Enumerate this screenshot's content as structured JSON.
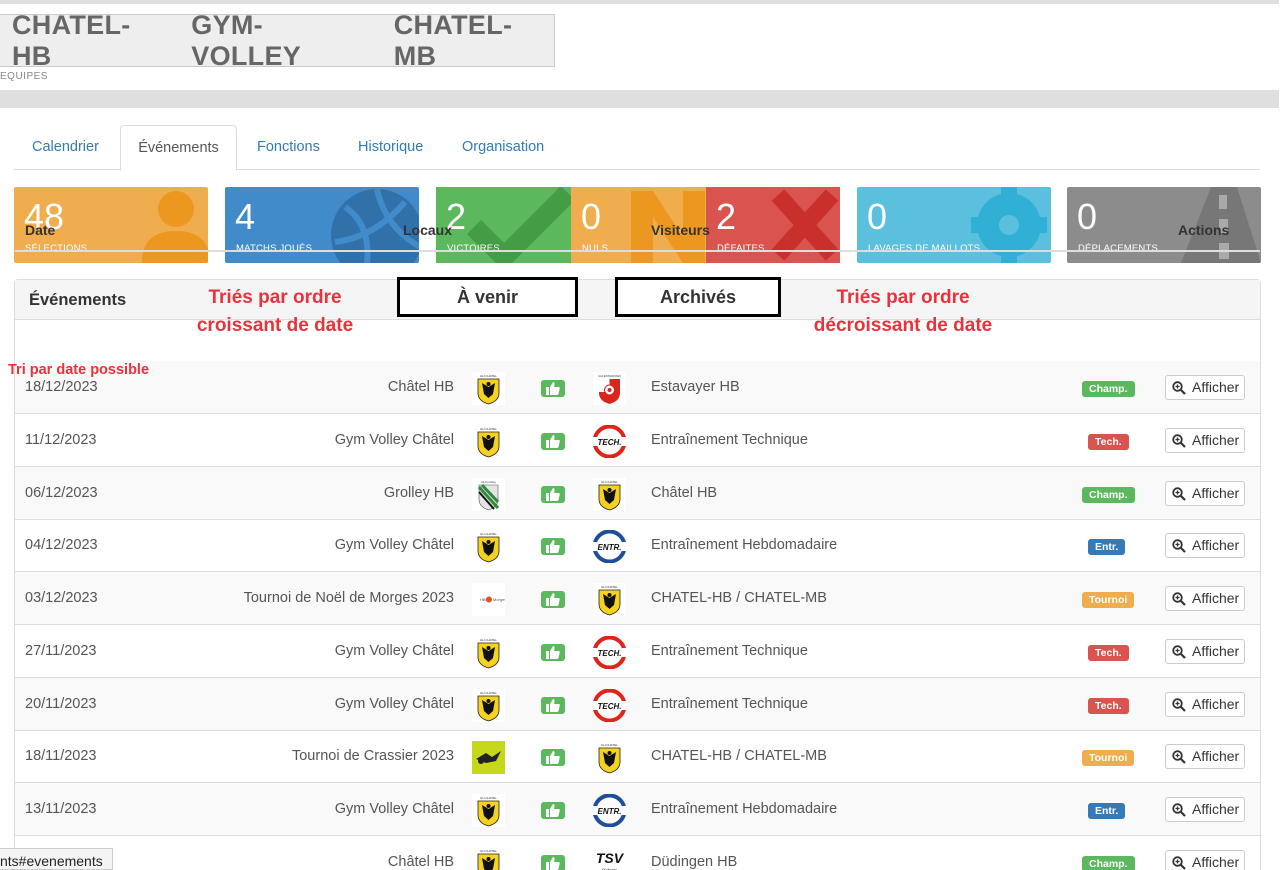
{
  "header": {
    "teams": [
      "CHATEL-HB",
      "GYM-VOLLEY",
      "CHATEL-MB"
    ],
    "subtitle": "EQUIPES"
  },
  "tabs": [
    {
      "label": "Calendrier",
      "active": false
    },
    {
      "label": "Événements",
      "active": true
    },
    {
      "label": "Fonctions",
      "active": false
    },
    {
      "label": "Historique",
      "active": false
    },
    {
      "label": "Organisation",
      "active": false
    }
  ],
  "stats": {
    "selections": {
      "value": "48",
      "label": "SÉLECTIONS",
      "color": "#f0ad4e"
    },
    "matchs": {
      "value": "4",
      "label": "MATCHS JOUÉS",
      "color": "#428bca"
    },
    "victoires": {
      "value": "2",
      "label": "VICTOIRES",
      "color": "#5cb85c"
    },
    "nuls": {
      "value": "0",
      "label": "NULS",
      "color": "#f0ad4e"
    },
    "defaites": {
      "value": "2",
      "label": "DÉFAITES",
      "color": "#d9534f"
    },
    "lavages": {
      "value": "0",
      "label": "LAVAGES DE MAILLOTS",
      "color": "#5bc0de"
    },
    "deplacements": {
      "value": "0",
      "label": "DÉPLACEMENTS",
      "color": "#8c8c8c"
    }
  },
  "events": {
    "title": "Événements",
    "upcoming_button": "À venir",
    "archived_button": "Archivés",
    "annotations": {
      "ascending_line1": "Triés par ordre",
      "ascending_line2": "croissant de date",
      "descending_line1": "Triés par ordre",
      "descending_line2": "décroissant de date",
      "sort_hint": "Tri par date possible"
    },
    "columns": {
      "date": "Date",
      "home": "Locaux",
      "visitors": "Visiteurs",
      "actions": "Actions"
    },
    "action_label": "Afficher",
    "rows": [
      {
        "date": "18/12/2023",
        "home": "Châtel HB",
        "home_logo": "chatel-logo",
        "visitors": "Estavayer HB",
        "visitor_logo": "estavayer-logo",
        "type": "Champ."
      },
      {
        "date": "11/12/2023",
        "home": "Gym Volley Châtel",
        "home_logo": "chatel-logo",
        "visitors": "Entraînement Technique",
        "visitor_logo": "tech-logo",
        "type": "Tech."
      },
      {
        "date": "06/12/2023",
        "home": "Grolley HB",
        "home_logo": "grolley-logo",
        "visitors": "Châtel HB",
        "visitor_logo": "chatel-logo",
        "type": "Champ."
      },
      {
        "date": "04/12/2023",
        "home": "Gym Volley Châtel",
        "home_logo": "chatel-logo",
        "visitors": "Entraînement Hebdomadaire",
        "visitor_logo": "entr-logo",
        "type": "Entr."
      },
      {
        "date": "03/12/2023",
        "home": "Tournoi de Noël de Morges 2023",
        "home_logo": "morges-logo",
        "visitors": "CHATEL-HB / CHATEL-MB",
        "visitor_logo": "chatel-logo",
        "type": "Tournoi"
      },
      {
        "date": "27/11/2023",
        "home": "Gym Volley Châtel",
        "home_logo": "chatel-logo",
        "visitors": "Entraînement Technique",
        "visitor_logo": "tech-logo",
        "type": "Tech."
      },
      {
        "date": "20/11/2023",
        "home": "Gym Volley Châtel",
        "home_logo": "chatel-logo",
        "visitors": "Entraînement Technique",
        "visitor_logo": "tech-logo",
        "type": "Tech."
      },
      {
        "date": "18/11/2023",
        "home": "Tournoi de Crassier 2023",
        "home_logo": "crassier-logo",
        "visitors": "CHATEL-HB / CHATEL-MB",
        "visitor_logo": "chatel-logo",
        "type": "Tournoi"
      },
      {
        "date": "13/11/2023",
        "home": "Gym Volley Châtel",
        "home_logo": "chatel-logo",
        "visitors": "Entraînement Hebdomadaire",
        "visitor_logo": "entr-logo",
        "type": "Entr."
      },
      {
        "date": "",
        "home": "Châtel HB",
        "home_logo": "chatel-logo",
        "visitors": "Düdingen HB",
        "visitor_logo": "tsv-logo",
        "type": "Champ."
      }
    ]
  },
  "status_bar": {
    "url": "nts#evenements"
  }
}
